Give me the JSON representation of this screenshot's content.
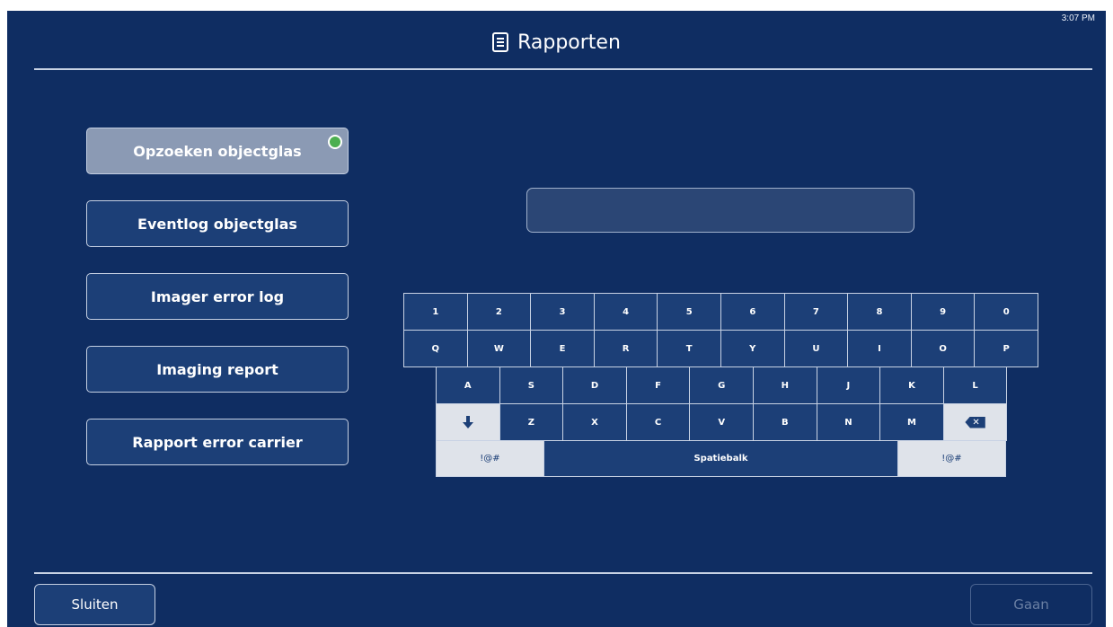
{
  "clock": "3:07 PM",
  "header": {
    "title": "Rapporten",
    "icon": "report-document-icon"
  },
  "menu": [
    {
      "label": "Opzoeken objectglas",
      "active": true
    },
    {
      "label": "Eventlog objectglas"
    },
    {
      "label": "Imager error log"
    },
    {
      "label": "Imaging report"
    },
    {
      "label": "Rapport error carrier"
    }
  ],
  "search": {
    "value": "",
    "placeholder": ""
  },
  "keyboard": {
    "row1": [
      "1",
      "2",
      "3",
      "4",
      "5",
      "6",
      "7",
      "8",
      "9",
      "0"
    ],
    "row2": [
      "Q",
      "W",
      "E",
      "R",
      "T",
      "Y",
      "U",
      "I",
      "O",
      "P"
    ],
    "row3": [
      "A",
      "S",
      "D",
      "F",
      "G",
      "H",
      "J",
      "K",
      "L"
    ],
    "row4": [
      "Z",
      "X",
      "C",
      "V",
      "B",
      "N",
      "M"
    ],
    "shift_icon": "down-arrow-icon",
    "backspace_icon": "backspace-icon",
    "symbols_left": "!@#",
    "space": "Spatiebalk",
    "symbols_right": "!@#"
  },
  "footer": {
    "close_label": "Sluiten",
    "go_label": "Gaan"
  },
  "colors": {
    "background": "#0f2d62",
    "button": "#1c3f77",
    "active_button": "#8b9ab4",
    "check": "#4caf50"
  }
}
